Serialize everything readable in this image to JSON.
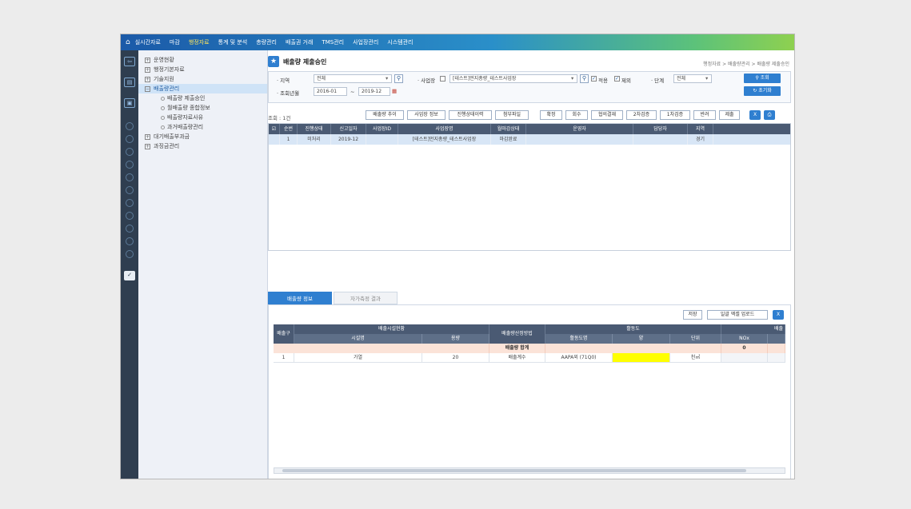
{
  "nav": {
    "menus": [
      "실시간자료",
      "마감",
      "행정자료",
      "통계 및 분석",
      "총량관리",
      "배출권 거래",
      "TMS관리",
      "사업장관리",
      "시스템관리"
    ],
    "active_index": 2
  },
  "tree": {
    "items": [
      "운영현황",
      "행정기본자료",
      "기술지원",
      "배출량관리",
      "대기배출부과금",
      "과징금관리"
    ],
    "selected_index": 3,
    "subitems": [
      "배출량 제출승인",
      "월배출량 종합정보",
      "배출량자료사유",
      "과거배출량관리"
    ]
  },
  "page": {
    "title": "배출량 제출승인",
    "breadcrumb": "행정자료 > 배출량관리 > 배출량 제출승인"
  },
  "filter": {
    "region_label": "· 지역",
    "region_value": "전체",
    "site_label": "· 사업장",
    "site_value": "[테스트]먼지총량_테스트사업장",
    "check_include": "적용",
    "check_exclude": "제외",
    "stage_label": "· 단계",
    "stage_value": "전체",
    "period_label": "· 조회년월",
    "period_from": "2016-01",
    "period_sep": "~",
    "period_to": "2019-12",
    "search_button": "조회",
    "reset_button": "초기화"
  },
  "toolbar": {
    "count": "조회 : 1건",
    "buttons": [
      "배출량 추이",
      "사업장 정보",
      "진행상태이력",
      "첨부파일",
      "확정",
      "회수",
      "협의결재",
      "2차검증",
      "1차검증",
      "반려",
      "제출"
    ]
  },
  "grid1": {
    "headers": [
      "순번",
      "진행상태",
      "신고일자",
      "사업장ID",
      "사업장명",
      "월마감상태",
      "운영자",
      "담당자",
      "지역"
    ],
    "rows": [
      [
        "1",
        "미처리",
        "2019-12",
        "",
        "[테스트]먼지총량_테스트사업장",
        "마감완료",
        "",
        "",
        "경기"
      ]
    ]
  },
  "tabs": [
    "배출량 정보",
    "자가측정 결과"
  ],
  "lower_toolbar": {
    "save": "저장",
    "excel_upload": "일괄 엑셀 업로드"
  },
  "grid2": {
    "h_group_outlet": "배출구",
    "h_group_facility": "배출시설현황",
    "h_group_method": "배출량산정방법",
    "h_group_activity": "활동도",
    "h_group_emission": "배출",
    "h_facility_name": "시설명",
    "h_capacity": "용량",
    "h_activity_fuel": "활동도명",
    "h_amount": "양",
    "h_unit": "단위",
    "h_nox": "NOx",
    "sum_label": "배출량 합계",
    "sum_value": "0",
    "row": {
      "outlet": "1",
      "facility": "가열",
      "capacity": "20",
      "method": "배출계수",
      "activity": "AAPA외 (71Q0)",
      "amount": "",
      "unit": "천㎥",
      "nox": ""
    },
    "highlight_color": "#ffff00"
  }
}
